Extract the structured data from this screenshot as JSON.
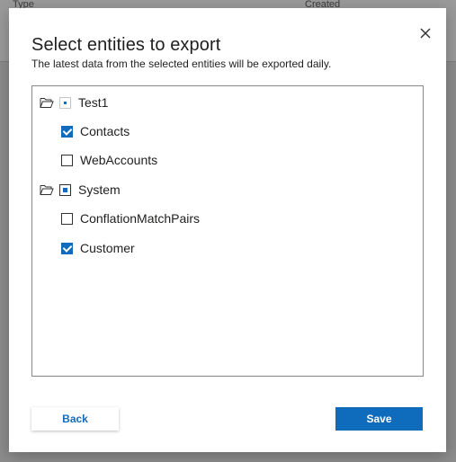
{
  "background": {
    "col_type": "Type",
    "col_created": "Created"
  },
  "dialog": {
    "title": "Select entities to export",
    "subtitle": "The latest data from the selected entities will be exported daily.",
    "close_icon": "close-icon"
  },
  "tree": {
    "groups": [
      {
        "label": "Test1",
        "icon": "folder-open-icon",
        "state": "partial",
        "children": [
          {
            "label": "Contacts",
            "checked": true
          },
          {
            "label": "WebAccounts",
            "checked": false
          }
        ]
      },
      {
        "label": "System",
        "icon": "folder-open-icon",
        "state": "partial",
        "children": [
          {
            "label": "ConflationMatchPairs",
            "checked": false
          },
          {
            "label": "Customer",
            "checked": true
          }
        ]
      }
    ]
  },
  "actions": {
    "back_label": "Back",
    "save_label": "Save"
  },
  "colors": {
    "accent": "#0f6cbd",
    "text": "#201f1e",
    "overlay": "#8c8c8c"
  }
}
